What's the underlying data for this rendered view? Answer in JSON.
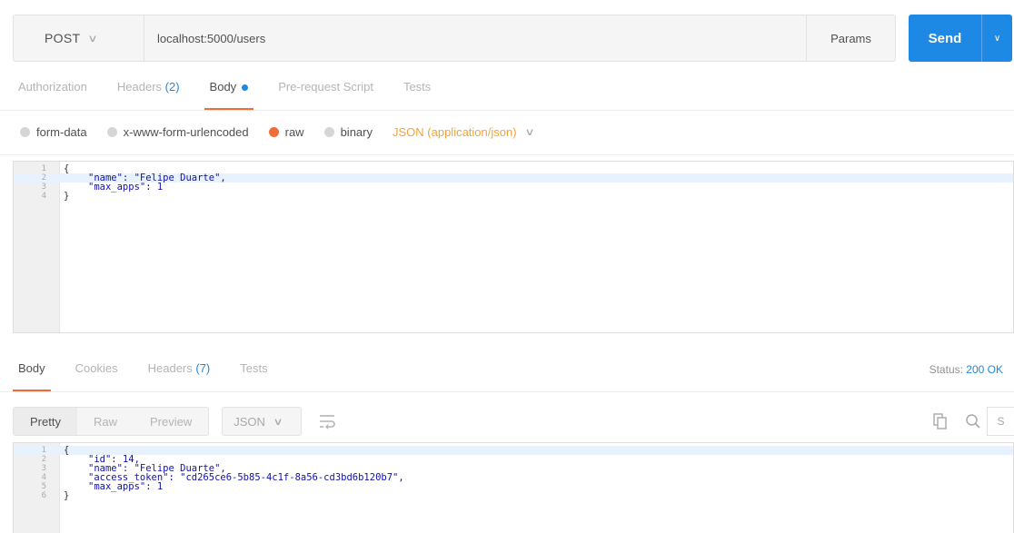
{
  "request": {
    "method": "POST",
    "url": "localhost:5000/users",
    "params_label": "Params",
    "send_label": "Send"
  },
  "request_tabs": [
    {
      "label": "Authorization"
    },
    {
      "label": "Headers",
      "count": "(2)"
    },
    {
      "label": "Body"
    },
    {
      "label": "Pre-request Script"
    },
    {
      "label": "Tests"
    }
  ],
  "body_types": [
    {
      "label": "form-data",
      "selected": false
    },
    {
      "label": "x-www-form-urlencoded",
      "selected": false
    },
    {
      "label": "raw",
      "selected": true
    },
    {
      "label": "binary",
      "selected": false
    }
  ],
  "content_type": "JSON (application/json)",
  "request_body": {
    "line_numbers": [
      "1",
      "2",
      "3",
      "4"
    ],
    "lines": [
      "{",
      "\"name\": \"Felipe Duarte\",",
      "\"max_apps\": 1",
      "}"
    ]
  },
  "response_tabs": [
    {
      "label": "Body"
    },
    {
      "label": "Cookies"
    },
    {
      "label": "Headers",
      "count": "(7)"
    },
    {
      "label": "Tests"
    }
  ],
  "status": {
    "label": "Status:",
    "value": "200 OK"
  },
  "view_modes": [
    "Pretty",
    "Raw",
    "Preview"
  ],
  "format": "JSON",
  "response_body": {
    "line_numbers": [
      "1",
      "2",
      "3",
      "4",
      "5",
      "6"
    ],
    "lines": [
      "{",
      "\"id\": 14,",
      "\"name\": \"Felipe Duarte\",",
      "\"access_token\": \"cd265ce6-5b85-4c1f-8a56-cd3bd6b120b7\",",
      "\"max_apps\": 1",
      "}"
    ]
  },
  "colors": {
    "accent": "#1e88e5",
    "active_tab": "#f26b3a",
    "content_type": "#f2a33a"
  },
  "icons": {
    "copy": "copy-icon",
    "search": "search-icon",
    "wrap": "wrap-lines-icon"
  }
}
